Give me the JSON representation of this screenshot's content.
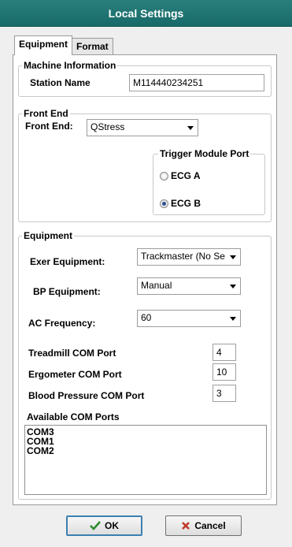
{
  "window": {
    "title": "Local Settings"
  },
  "tabs": [
    {
      "label": "Equipment",
      "active": true
    },
    {
      "label": "Format",
      "active": false
    }
  ],
  "machine_info": {
    "legend": "Machine Information",
    "station_label": "Station Name",
    "station_value": "M114440234251"
  },
  "front_end": {
    "legend": "Front End",
    "label": "Front End:",
    "value": "QStress",
    "trigger": {
      "legend": "Trigger Module Port",
      "options": [
        {
          "label": "ECG A",
          "checked": false
        },
        {
          "label": "ECG B",
          "checked": true
        }
      ]
    }
  },
  "equipment": {
    "legend": "Equipment",
    "exer_label": "Exer Equipment:",
    "exer_value": "Trackmaster (No Se",
    "bp_label": "BP Equipment:",
    "bp_value": "Manual",
    "ac_label": "AC Frequency:",
    "ac_value": "60",
    "treadmill_label": "Treadmill COM Port",
    "treadmill_value": "4",
    "ergometer_label": "Ergometer COM Port",
    "ergometer_value": "10",
    "bp_com_label": "Blood Pressure COM Port",
    "bp_com_value": "3",
    "available_label": "Available COM Ports",
    "available_ports": [
      "COM3",
      "COM1",
      "COM2"
    ]
  },
  "buttons": {
    "ok": "OK",
    "cancel": "Cancel"
  },
  "colors": {
    "titlebar": "#1f7573",
    "ok_check": "#2e8b2e",
    "cancel_x": "#c0392b"
  }
}
